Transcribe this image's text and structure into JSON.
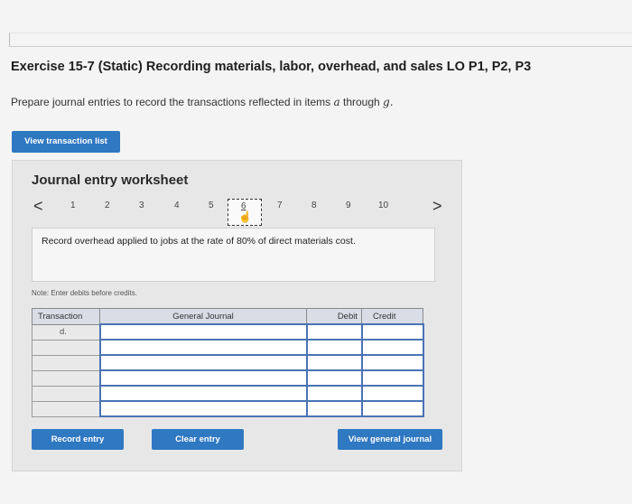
{
  "exercise": {
    "title": "Exercise 15-7 (Static) Recording materials, labor, overhead, and sales LO P1, P2, P3",
    "instruction_prefix": "Prepare journal entries to record the transactions reflected in items ",
    "instruction_a": "a",
    "instruction_mid": " through ",
    "instruction_g": "g."
  },
  "buttons": {
    "view_transaction_list": "View transaction list",
    "record_entry": "Record entry",
    "clear_entry": "Clear entry",
    "view_general_journal": "View general journal"
  },
  "worksheet": {
    "title": "Journal entry worksheet",
    "prev_arrow": "<",
    "next_arrow": ">",
    "pages": [
      "1",
      "2",
      "3",
      "4",
      "5",
      "6",
      "7",
      "8",
      "9",
      "10"
    ],
    "active_page": "6",
    "description": "Record overhead applied to jobs at the rate of 80% of direct materials cost.",
    "note": "Note: Enter debits before credits."
  },
  "table": {
    "headers": {
      "transaction": "Transaction",
      "general_journal": "General Journal",
      "debit": "Debit",
      "credit": "Credit"
    },
    "transaction_label": "d."
  }
}
